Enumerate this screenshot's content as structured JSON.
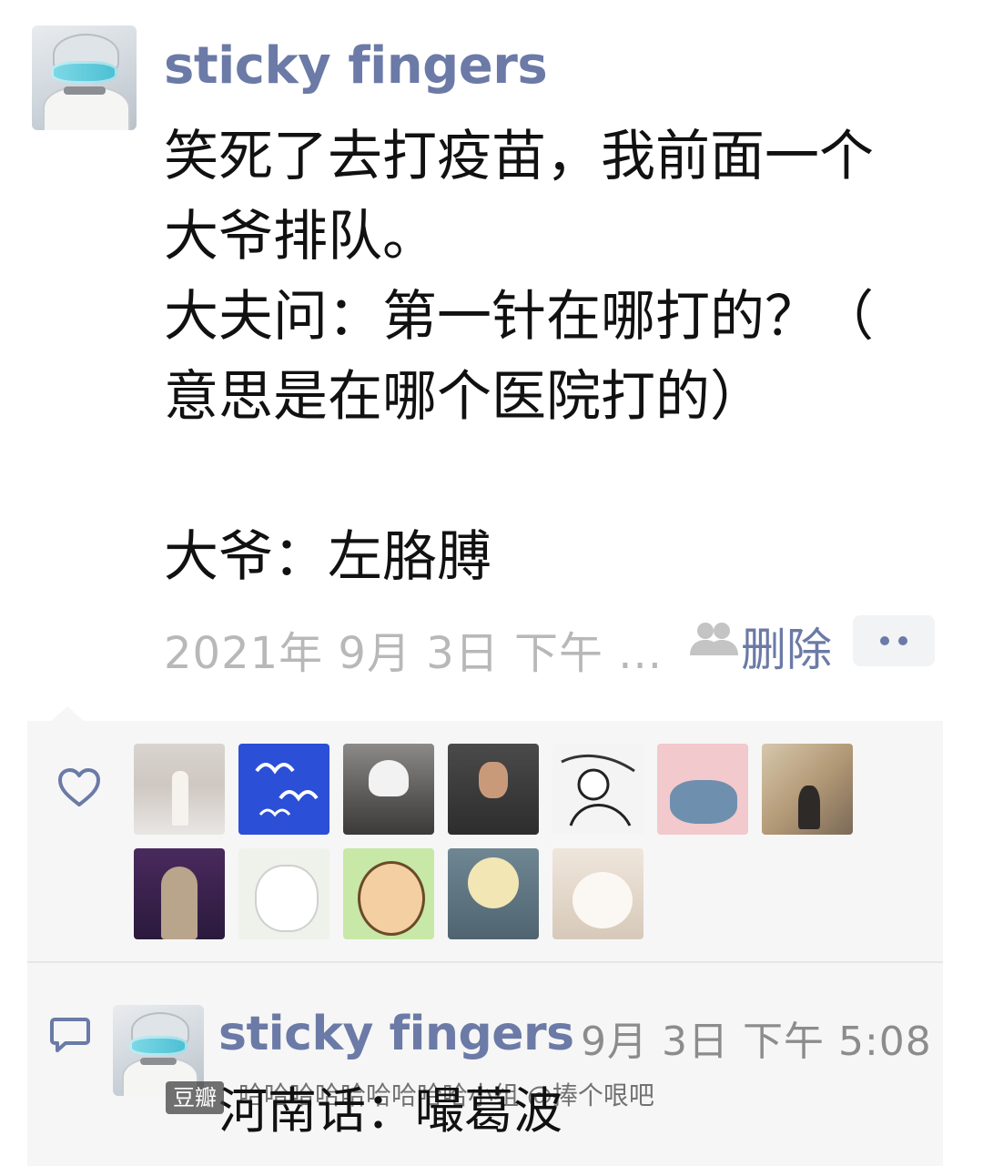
{
  "post": {
    "username": "sticky fingers",
    "lines": [
      "笑死了去打疫苗，我前面一个",
      "大爷排队。",
      "大夫问：第一针在哪打的？（",
      "意思是在哪个医院打的）",
      "",
      "大爷：左胳膊"
    ],
    "time": "2021年 9月 3日 下午 ...",
    "delete_label": "删除"
  },
  "icons": {
    "author_avatar": "robot-dog-avatar",
    "visibility": "people-icon",
    "more": "more-dots-icon",
    "like": "heart-icon",
    "comment": "comment-bubble-icon"
  },
  "colors": {
    "link": "#6b7aa6",
    "muted": "#b8b8b8",
    "panel": "#f6f6f6",
    "white": "#ffffff"
  },
  "likes": {
    "count": 12
  },
  "comment": {
    "username": "sticky fingers",
    "time": "9月 3日 下午 5:08",
    "text": "河南话：嘬葛波"
  },
  "watermark": {
    "badge": "豆瓣",
    "text": "哈哈哈哈哈哈哈哈哈小组 @捧个哏吧"
  }
}
